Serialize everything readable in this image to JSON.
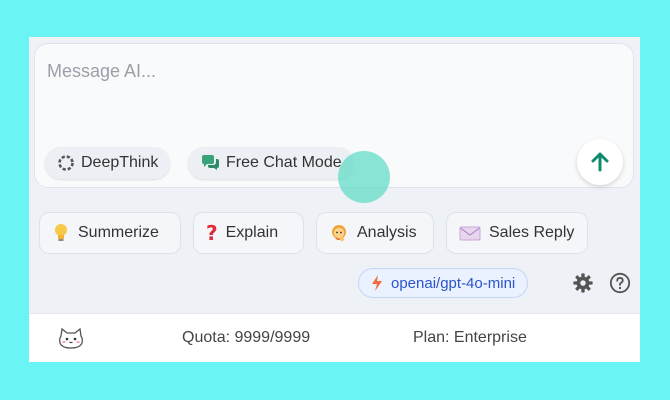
{
  "composer": {
    "placeholder": "Message AI...",
    "modes": {
      "deepthink": "DeepThink",
      "freechat": "Free Chat Mode"
    }
  },
  "actions": {
    "summarize": "Summerize",
    "explain": "Explain",
    "analysis": "Analysis",
    "sales_reply": "Sales Reply"
  },
  "model": {
    "name": "openai/gpt-4o-mini"
  },
  "footer": {
    "quota": "Quota: 9999/9999",
    "plan": "Plan: Enterprise"
  },
  "icons": {
    "deepthink": "spinner-icon",
    "freechat": "chat-bubbles-icon",
    "send": "arrow-up-icon",
    "summarize": "lightbulb-icon",
    "explain": "question-mark-icon",
    "analysis": "person-thinking-icon",
    "sales_reply": "envelope-icon",
    "model": "lightning-icon",
    "settings": "gear-icon",
    "help": "help-circle-icon",
    "avatar": "cat-avatar-icon"
  },
  "colors": {
    "page_background": "#6af4f4",
    "send_arrow": "#0f8a6e",
    "model_text": "#2b55c9",
    "model_badge_bg": "#eaf1ff"
  }
}
